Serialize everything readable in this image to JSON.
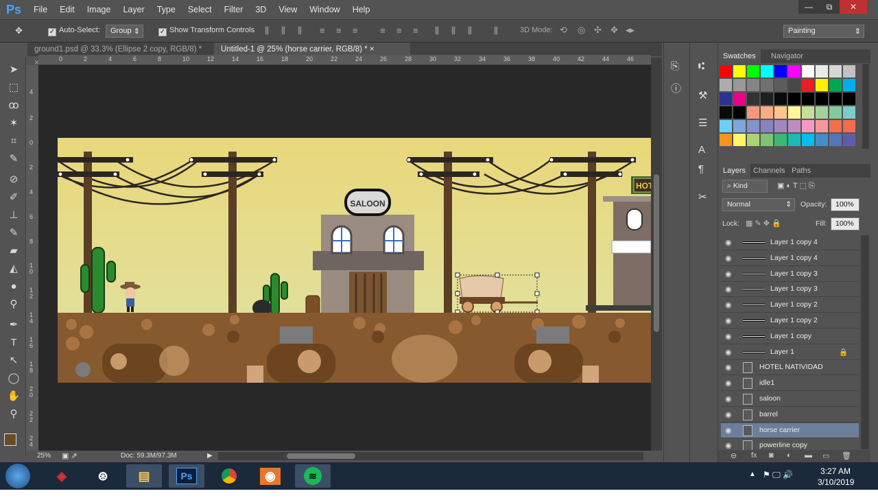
{
  "app": {
    "logo": "Ps"
  },
  "menu": [
    "File",
    "Edit",
    "Image",
    "Layer",
    "Type",
    "Select",
    "Filter",
    "3D",
    "View",
    "Window",
    "Help"
  ],
  "window_controls": {
    "minimize": "—",
    "restore": "⧉",
    "close": "✕"
  },
  "options": {
    "auto_select_label": "Auto-Select:",
    "auto_select_value": "Group",
    "show_transform_label": "Show Transform Controls",
    "mode_3d_label": "3D Mode:",
    "workspace": "Painting"
  },
  "tabs": [
    {
      "label": "ground1.psd @ 33.3% (Ellipse 2 copy, RGB/8) *",
      "close": "×"
    },
    {
      "label": "Untitled-1 @ 25% (horse carrier, RGB/8) *",
      "close": "×"
    }
  ],
  "ruler": {
    "h_ticks": [
      "0",
      "2",
      "4",
      "6",
      "8",
      "10",
      "12",
      "14",
      "16",
      "18",
      "20",
      "22",
      "24",
      "26",
      "28",
      "30",
      "32",
      "34",
      "36",
      "38",
      "40",
      "42",
      "44",
      "46"
    ],
    "v_ticks": [
      "4",
      "2",
      "0",
      "2",
      "4",
      "6",
      "8",
      "1 0",
      "1 2",
      "1 4",
      "1 6",
      "1 8",
      "2 0",
      "2 2",
      "2 4"
    ]
  },
  "canvas": {
    "saloon_sign": "SALOON",
    "hotel_sign": "HOT"
  },
  "status": {
    "zoom": "25%",
    "doc": "Doc: 59.3M/97.3M"
  },
  "swatches_panel": {
    "tabs": [
      "Swatches",
      "Navigator"
    ],
    "colors": [
      "#ff0000",
      "#ffff00",
      "#00ff00",
      "#00ffff",
      "#0000ff",
      "#ff00ff",
      "#ffffff",
      "#ebebeb",
      "#d6d6d6",
      "#c2c2c2",
      "#adadad",
      "#999999",
      "#858585",
      "#707070",
      "#5c5c5c",
      "#474747",
      "#ed1c24",
      "#fff200",
      "#00a651",
      "#00aeef",
      "#2e3192",
      "#ec008c",
      "#333333",
      "#1f1f1f",
      "#0a0a0a",
      "#000000",
      "#000000",
      "#000000",
      "#000000",
      "#000000",
      "#0a0a0a",
      "#000000",
      "#f7977a",
      "#f9ad81",
      "#fdc68a",
      "#fff79a",
      "#c4df9b",
      "#a3d39c",
      "#82ca9d",
      "#7bcdc8",
      "#6ecff6",
      "#7ea7d8",
      "#8493ca",
      "#8882be",
      "#a187be",
      "#bc8dbf",
      "#f49ac2",
      "#f6989d",
      "#ef6f4f",
      "#f26c4f",
      "#f7941d",
      "#fff568",
      "#acd373",
      "#7cc576",
      "#3bb878",
      "#1abbb4",
      "#00bff3",
      "#448ccb",
      "#5574b9",
      "#605ca8"
    ]
  },
  "layers_panel": {
    "tabs": [
      "Layers",
      "Channels",
      "Paths"
    ],
    "filter": "Kind",
    "blend_mode": "Normal",
    "opacity_label": "Opacity:",
    "opacity": "100%",
    "lock_label": "Lock:",
    "fill_label": "Fill:",
    "fill": "100%",
    "layers": [
      {
        "name": "Layer 1 copy 4",
        "kind": "pixel",
        "locked": false,
        "selected": false
      },
      {
        "name": "Layer 1 copy 4",
        "kind": "pixel",
        "locked": false,
        "selected": false
      },
      {
        "name": "Layer 1 copy 3",
        "kind": "pixel",
        "locked": false,
        "selected": false
      },
      {
        "name": "Layer 1 copy 3",
        "kind": "pixel",
        "locked": false,
        "selected": false
      },
      {
        "name": "Layer 1 copy 2",
        "kind": "pixel",
        "locked": false,
        "selected": false
      },
      {
        "name": "Layer 1 copy 2",
        "kind": "pixel",
        "locked": false,
        "selected": false
      },
      {
        "name": "Layer 1 copy",
        "kind": "pixel",
        "locked": false,
        "selected": false
      },
      {
        "name": "Layer 1",
        "kind": "pixel",
        "locked": true,
        "selected": false
      },
      {
        "name": "HOTEL NATIVIDAD",
        "kind": "smart",
        "locked": false,
        "selected": false
      },
      {
        "name": "idle1",
        "kind": "smart",
        "locked": false,
        "selected": false
      },
      {
        "name": "saloon",
        "kind": "smart",
        "locked": false,
        "selected": false
      },
      {
        "name": "barrel",
        "kind": "smart",
        "locked": false,
        "selected": false
      },
      {
        "name": "horse carrier",
        "kind": "smart",
        "locked": false,
        "selected": true
      },
      {
        "name": "powerline copy",
        "kind": "smart",
        "locked": false,
        "selected": false
      }
    ]
  },
  "taskbar": {
    "time": "3:27 AM",
    "date": "3/10/2019",
    "ps_label": "Ps"
  }
}
